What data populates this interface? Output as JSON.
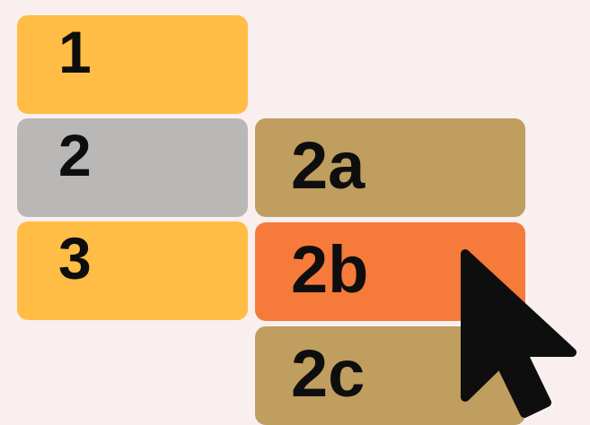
{
  "menu": {
    "items": [
      {
        "label": "1",
        "state": "default",
        "color": "#FFBD45"
      },
      {
        "label": "2",
        "state": "open",
        "color": "#BAB7B7"
      },
      {
        "label": "3",
        "state": "default",
        "color": "#FFBD45"
      }
    ]
  },
  "submenu": {
    "parent": "2",
    "items": [
      {
        "label": "2a",
        "state": "default",
        "color": "#BF9E5F"
      },
      {
        "label": "2b",
        "state": "hovered",
        "color": "#F67A3A"
      },
      {
        "label": "2c",
        "state": "default",
        "color": "#BF9E5F"
      }
    ]
  },
  "cursor": {
    "icon": "arrow-cursor-icon",
    "color": "#0E0E0E",
    "hovering": "2b"
  },
  "colors": {
    "background": "#FAEFEF",
    "text": "#0E0E0E"
  }
}
